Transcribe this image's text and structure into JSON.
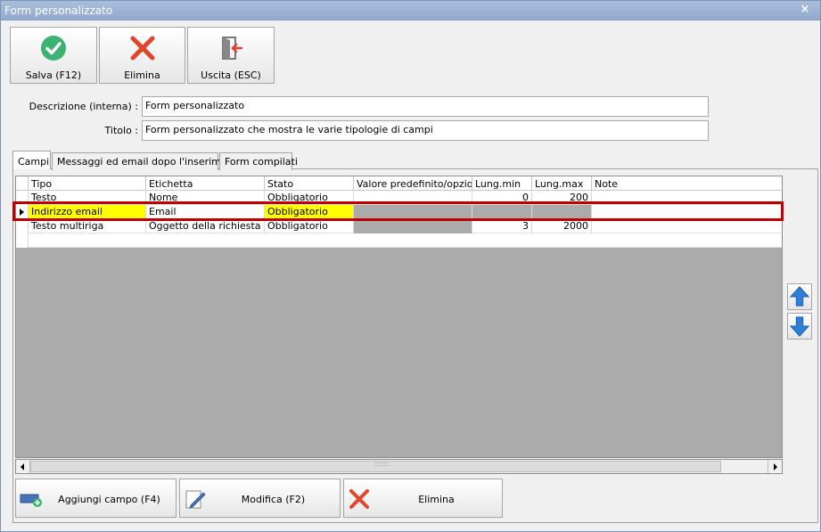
{
  "window": {
    "title": "Form personalizzato",
    "close_glyph": "×"
  },
  "toolbar": {
    "save": {
      "label": "Salva (F12)",
      "icon": "check-icon",
      "color": "#3cb371"
    },
    "delete": {
      "label": "Elimina",
      "icon": "x-icon",
      "color": "#e3442c"
    },
    "exit": {
      "label": "Uscita (ESC)",
      "icon": "exit-door-icon",
      "color": "#e3442c"
    }
  },
  "form": {
    "description_label": "Descrizione (interna) :",
    "description_value": "Form personalizzato",
    "title_label": "Titolo :",
    "title_value": "Form personalizzato che mostra le varie tipologie di campi"
  },
  "tabs": [
    {
      "label": "Campi",
      "active": true
    },
    {
      "label": "Messaggi ed email dopo l'inserimento",
      "active": false
    },
    {
      "label": "Form compilati",
      "active": false
    }
  ],
  "grid": {
    "columns": [
      "Tipo",
      "Etichetta",
      "Stato",
      "Valore predefinito/opzioni",
      "Lung.min",
      "Lung.max",
      "Note"
    ],
    "rows": [
      [
        "Testo",
        "Nome",
        "Obbligatorio",
        "",
        "0",
        "200",
        ""
      ],
      [
        "Indirizzo email",
        "Email",
        "Obbligatorio",
        "",
        "",
        "",
        ""
      ],
      [
        "Testo multiriga",
        "Oggetto della richiesta",
        "Obbligatorio",
        "",
        "3",
        "2000",
        ""
      ]
    ],
    "selected_row": 1,
    "highlight_color": "#c00000",
    "yellow_color": "#ffff00",
    "scroll_grip": "::::::"
  },
  "side_buttons": {
    "up_icon": "arrow-up-icon",
    "down_icon": "arrow-down-icon",
    "color": "#2f7fd6"
  },
  "bottom_buttons": {
    "add": {
      "label": "Aggiungi campo (F4)",
      "icon": "add-field-icon"
    },
    "edit": {
      "label": "Modifica (F2)",
      "icon": "edit-icon"
    },
    "delete": {
      "label": "Elimina",
      "icon": "x-icon"
    }
  }
}
